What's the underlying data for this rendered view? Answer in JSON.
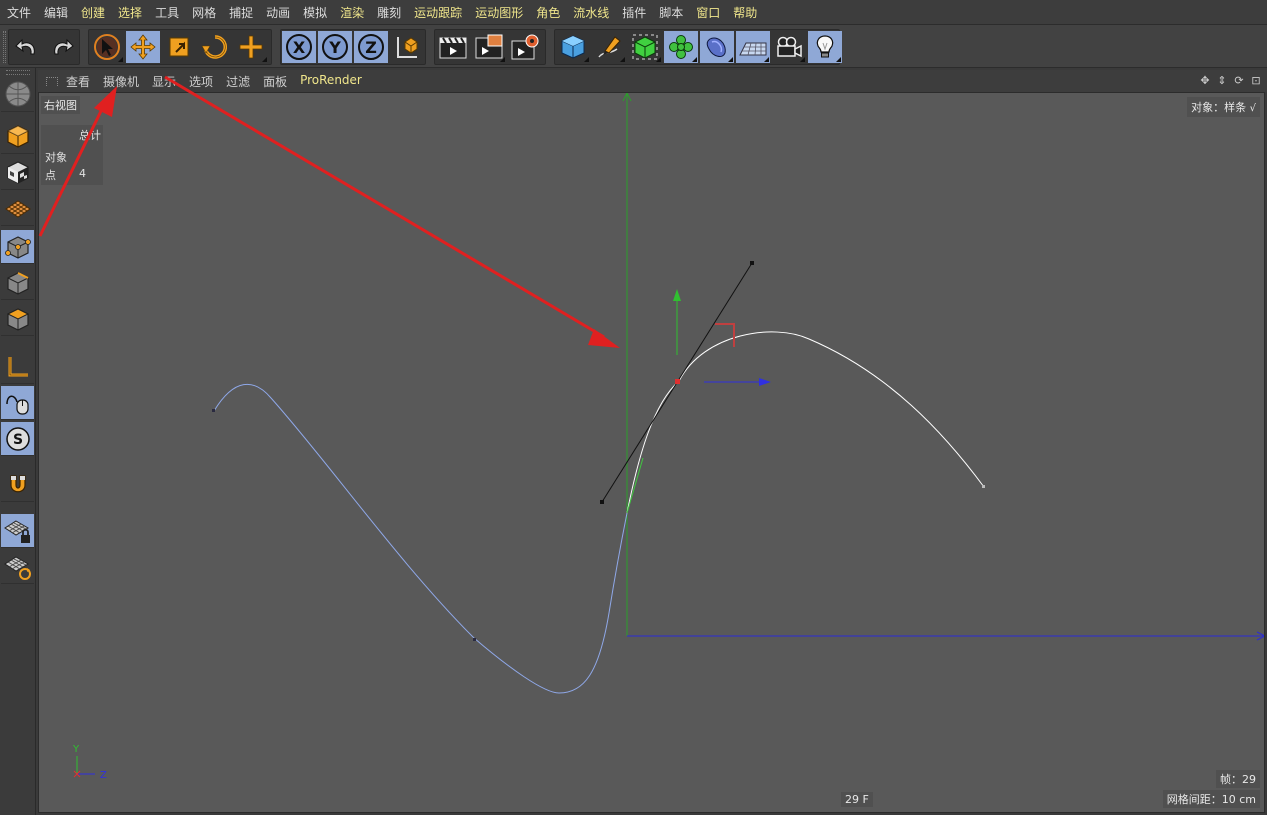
{
  "menubar": {
    "items": [
      {
        "label": "文件",
        "hl": false
      },
      {
        "label": "编辑",
        "hl": false
      },
      {
        "label": "创建",
        "hl": true
      },
      {
        "label": "选择",
        "hl": true
      },
      {
        "label": "工具",
        "hl": false
      },
      {
        "label": "网格",
        "hl": false
      },
      {
        "label": "捕捉",
        "hl": false
      },
      {
        "label": "动画",
        "hl": false
      },
      {
        "label": "模拟",
        "hl": false
      },
      {
        "label": "渲染",
        "hl": true
      },
      {
        "label": "雕刻",
        "hl": false
      },
      {
        "label": "运动跟踪",
        "hl": true
      },
      {
        "label": "运动图形",
        "hl": true
      },
      {
        "label": "角色",
        "hl": true
      },
      {
        "label": "流水线",
        "hl": true
      },
      {
        "label": "插件",
        "hl": false
      },
      {
        "label": "脚本",
        "hl": false
      },
      {
        "label": "窗口",
        "hl": true
      },
      {
        "label": "帮助",
        "hl": true
      }
    ]
  },
  "toolbar": {
    "undo_icon": "undo-icon",
    "redo_icon": "redo-icon",
    "tools": [
      "select-icon",
      "move-icon",
      "scale-icon",
      "rotate-icon",
      "live-add-icon"
    ],
    "axis_lock": [
      "X",
      "Y",
      "Z"
    ],
    "render_icons": [
      "render-view-icon",
      "render-picture-viewer-icon",
      "render-settings-icon"
    ],
    "object_icons": [
      "cube-icon",
      "pen-spline-icon",
      "subdivision-icon",
      "cloner-icon",
      "deformer-icon",
      "floor-icon",
      "camera-icon",
      "light-icon"
    ]
  },
  "palette": {
    "icons": [
      "model-mode-icon",
      "texture-mode-icon",
      "workplane-icon",
      "points-mode-icon",
      "edges-mode-icon",
      "polygons-mode-icon",
      "axis-mode-icon",
      "tweak-mode-icon",
      "solo-icon",
      "snap-magnet-icon",
      "workplane-lock-icon",
      "workplane-align-icon"
    ]
  },
  "viewport_header": {
    "menus": [
      "查看",
      "摄像机",
      "显示",
      "选项",
      "过滤",
      "面板",
      "ProRender"
    ]
  },
  "viewport": {
    "view_name": "右视图",
    "hud": {
      "header": "总计",
      "row1_label": "对象",
      "row2_label": "点",
      "row2_value": "4"
    },
    "object_mode": "对象：样条",
    "frame_info": "帧：29",
    "frame_center": "29 F",
    "grid_spacing": "网格间距：10 cm",
    "axis_labels": {
      "y": "Y",
      "z": "Z"
    }
  },
  "colors": {
    "viewport_bg": "#595959",
    "active_button": "#8fa8d6",
    "menu_highlight": "#f0e68c",
    "spline_selected": "#ffffff",
    "spline_unselected": "#8fa8e8",
    "axis_y": "#2aa02a",
    "axis_z": "#2a2ad8",
    "annotation_arrow": "#e02020"
  }
}
